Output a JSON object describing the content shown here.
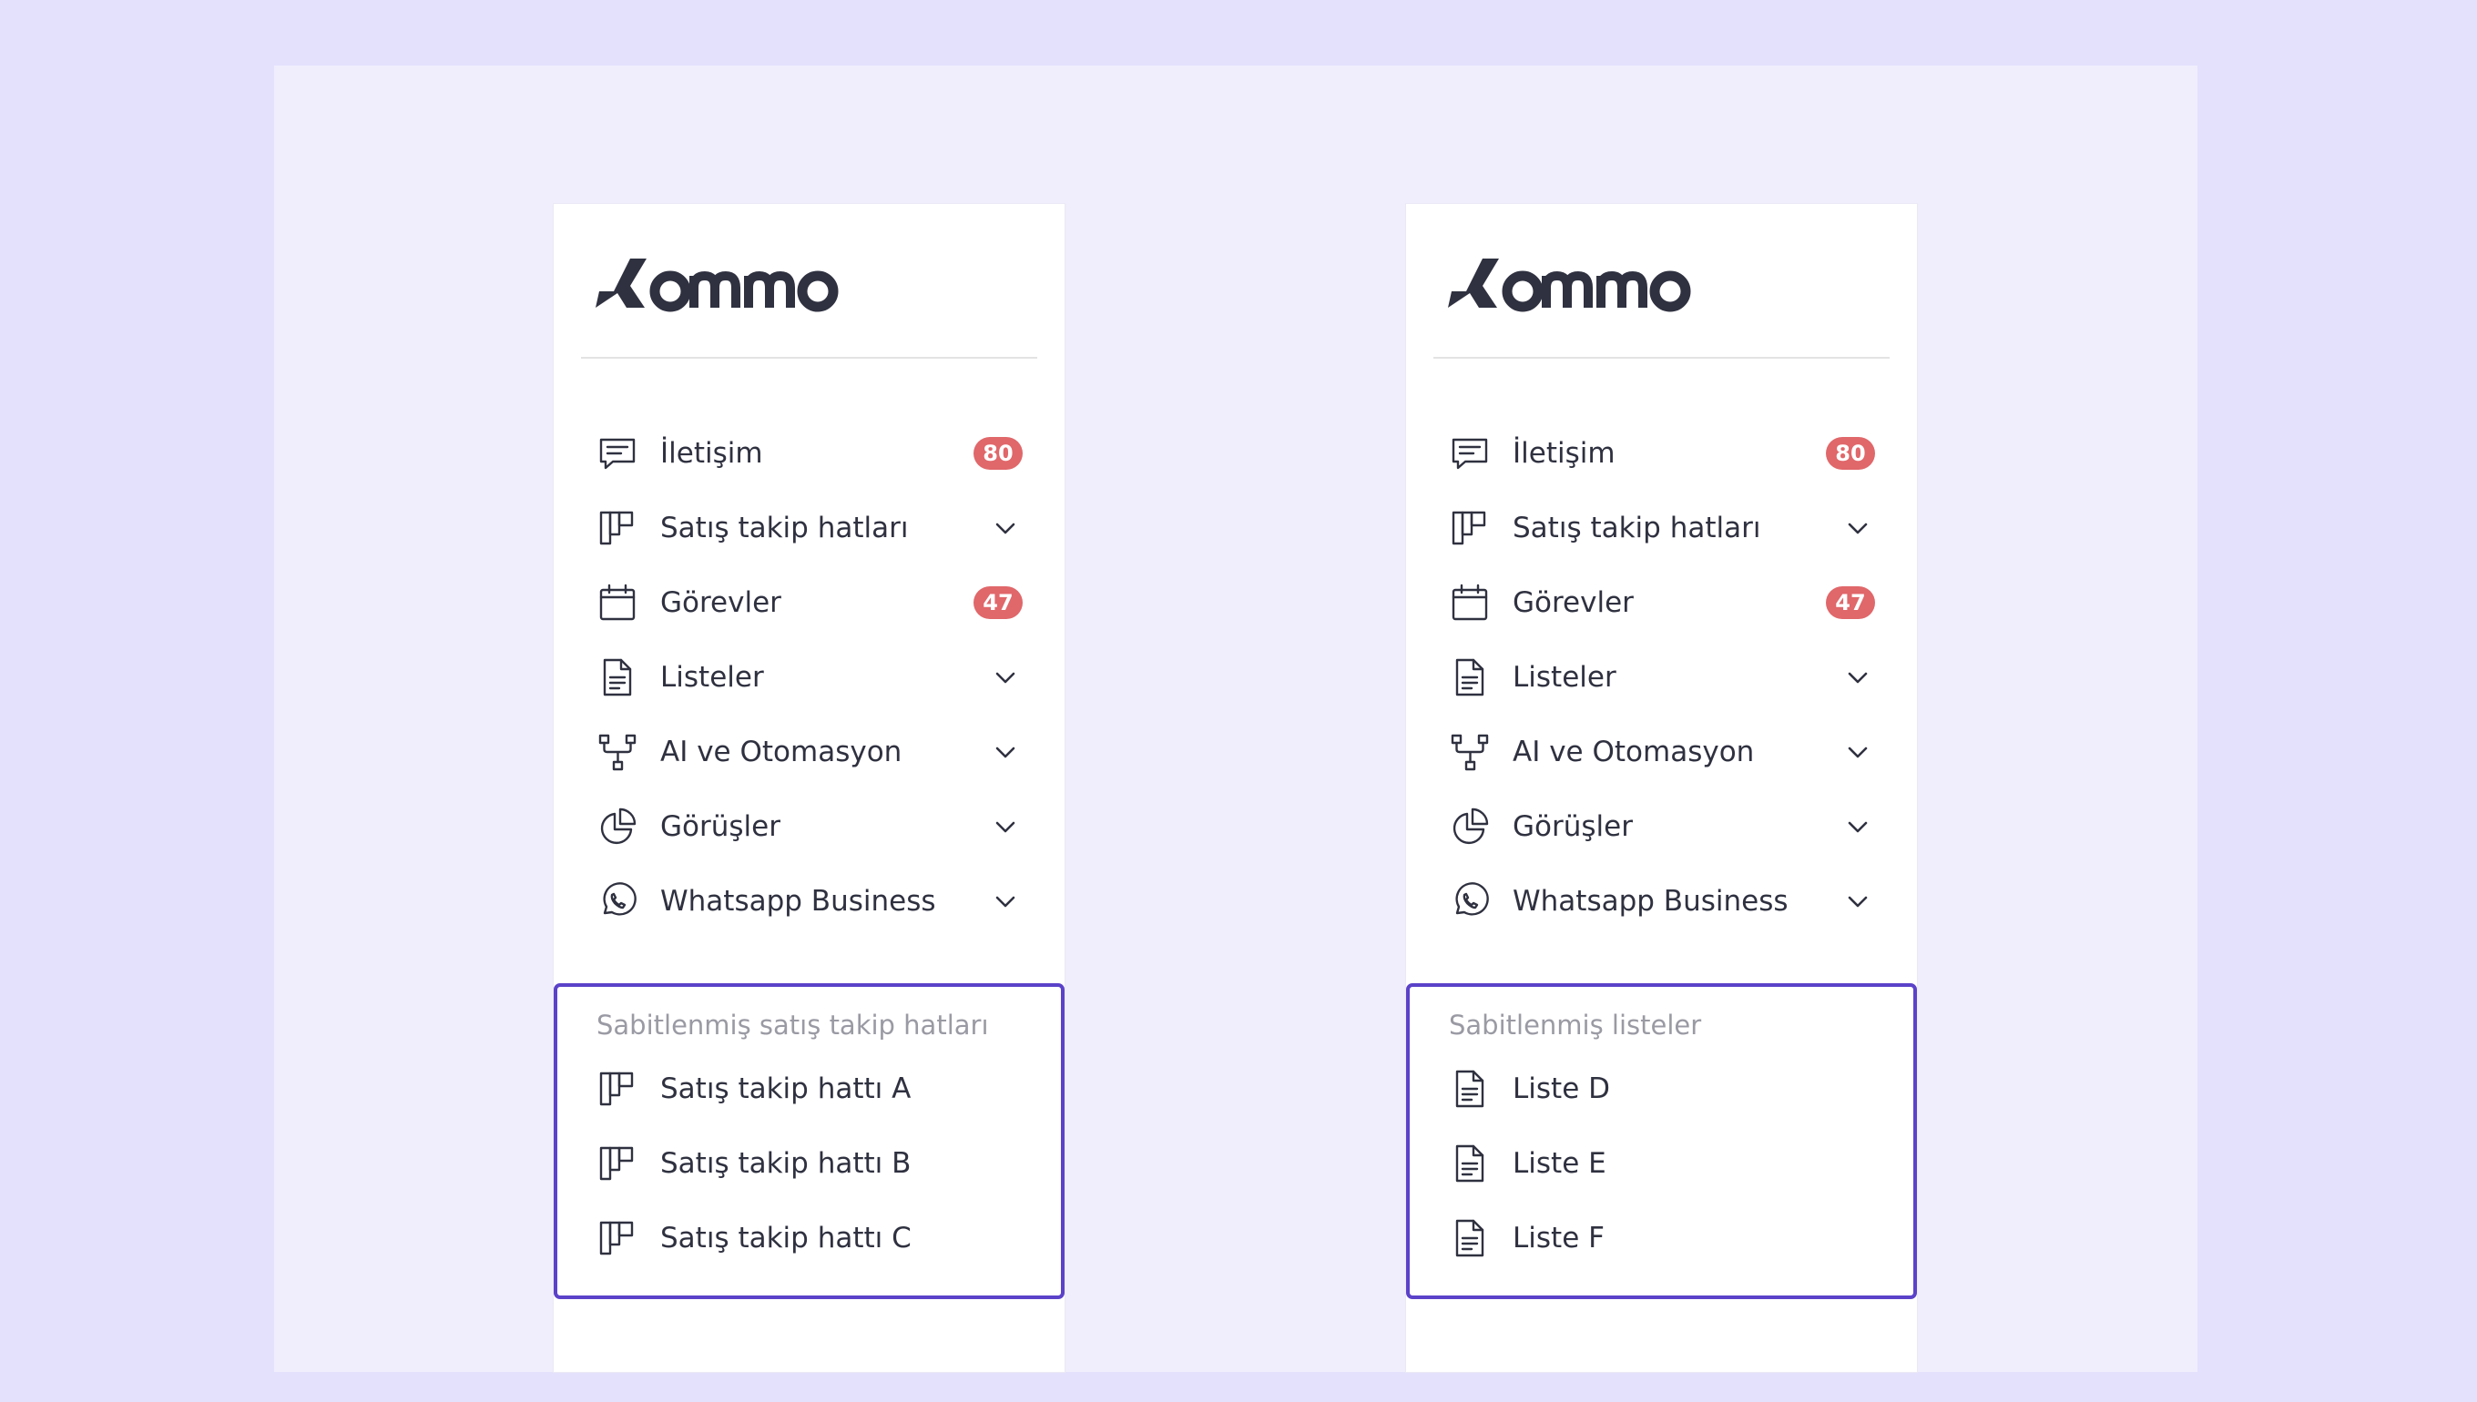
{
  "panels": [
    {
      "logo_text": "Kommo",
      "nav": [
        {
          "label": "İletişim",
          "icon": "chat-icon",
          "badge": "80"
        },
        {
          "label": "Satış takip hatları",
          "icon": "pipeline-icon",
          "chevron": true
        },
        {
          "label": "Görevler",
          "icon": "calendar-icon",
          "badge": "47"
        },
        {
          "label": "Listeler",
          "icon": "document-icon",
          "chevron": true
        },
        {
          "label": "AI ve Otomasyon",
          "icon": "automation-icon",
          "chevron": true
        },
        {
          "label": "Görüşler",
          "icon": "pie-chart-icon",
          "chevron": true
        },
        {
          "label": "Whatsapp Business",
          "icon": "whatsapp-icon",
          "chevron": true
        }
      ],
      "pinned": {
        "title": "Sabitlenmiş satış takip hatları",
        "items": [
          {
            "label": "Satış takip hattı A",
            "icon": "pipeline-icon"
          },
          {
            "label": "Satış takip hattı B",
            "icon": "pipeline-icon"
          },
          {
            "label": "Satış takip hattı C",
            "icon": "pipeline-icon"
          }
        ]
      }
    },
    {
      "logo_text": "Kommo",
      "nav": [
        {
          "label": "İletişim",
          "icon": "chat-icon",
          "badge": "80"
        },
        {
          "label": "Satış takip hatları",
          "icon": "pipeline-icon",
          "chevron": true
        },
        {
          "label": "Görevler",
          "icon": "calendar-icon",
          "badge": "47"
        },
        {
          "label": "Listeler",
          "icon": "document-icon",
          "chevron": true
        },
        {
          "label": "AI ve Otomasyon",
          "icon": "automation-icon",
          "chevron": true
        },
        {
          "label": "Görüşler",
          "icon": "pie-chart-icon",
          "chevron": true
        },
        {
          "label": "Whatsapp Business",
          "icon": "whatsapp-icon",
          "chevron": true
        }
      ],
      "pinned": {
        "title": "Sabitlenmiş listeler",
        "items": [
          {
            "label": "Liste D",
            "icon": "document-icon"
          },
          {
            "label": "Liste E",
            "icon": "document-icon"
          },
          {
            "label": "Liste F",
            "icon": "document-icon"
          }
        ]
      }
    }
  ],
  "colors": {
    "page_background": "#e4e1fd",
    "stage_background": "#f0eefd",
    "badge": "#e0676a",
    "pinned_border": "#5b42c9",
    "text": "#2f3140",
    "muted_text": "#9a9aa4"
  }
}
